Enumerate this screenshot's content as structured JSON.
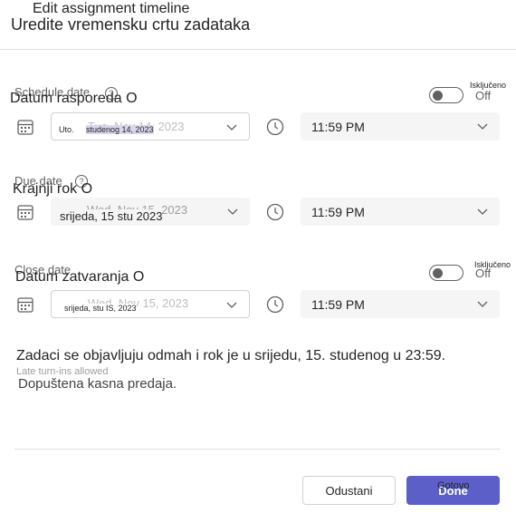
{
  "dialog": {
    "title": "Uredite vremensku crtu zadataka",
    "title_ghost": "Edit assignment timeline"
  },
  "schedule": {
    "ghost_label": "Schedule date",
    "label": "Datum rasporeda O",
    "toggle_ghost": "Off",
    "toggle_label": "Isključeno",
    "toggle_on": false,
    "date_ghost": "Tue, Nov 14, 2023",
    "date_day": "Uto.",
    "date_value": "studenog 14, 2023",
    "time_value": "11:59 PM"
  },
  "due": {
    "ghost_label": "Due date",
    "label": "Krajnji rok O",
    "date_ghost": "Wed, Nov 15, 2023",
    "date_value": "srijeda, 15 stu 2023",
    "time_value": "11:59 PM"
  },
  "close": {
    "ghost_label": "Close date",
    "label": "Datum zatvaranja O",
    "toggle_ghost": "Off",
    "toggle_label": "Isključeno",
    "toggle_on": false,
    "date_ghost": "Wed, Nov 15, 2023",
    "date_value": "srijeda, stu IS, 2023",
    "time_value": "11:59 PM"
  },
  "summary": {
    "message": "Zadaci se objavljuju odmah i rok je u srijedu, 15. studenog u 23:59.",
    "ghost_note": "Late turn-ins allowed",
    "note": "Dopuštena kasna predaja."
  },
  "footer": {
    "cancel_label": "Odustani",
    "done_ghost": "Done",
    "done_label": "Gotovo"
  },
  "colors": {
    "accent": "#5b5fc7",
    "field_bg": "#f5f5f5",
    "divider": "#e0e0e0"
  }
}
